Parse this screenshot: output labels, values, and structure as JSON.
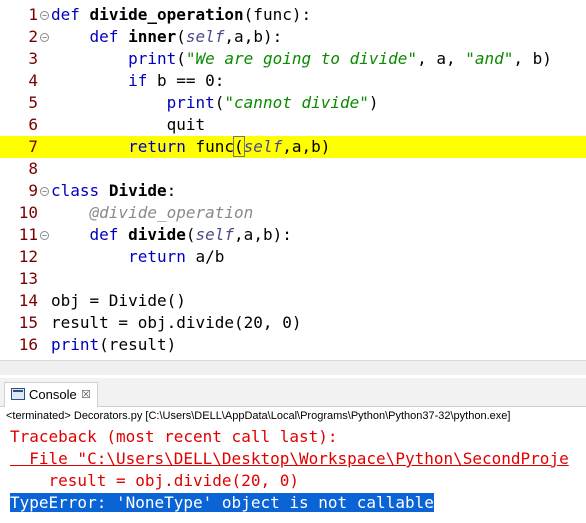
{
  "editor": {
    "lines": [
      {
        "num": "1",
        "fold": true,
        "highlight": false,
        "tokens": [
          {
            "t": "def",
            "c": "kw"
          },
          {
            "t": " "
          },
          {
            "t": "divide_operation",
            "c": "b"
          },
          {
            "t": "(func):"
          }
        ]
      },
      {
        "num": "2",
        "fold": true,
        "highlight": false,
        "tokens": [
          {
            "t": "    "
          },
          {
            "t": "def",
            "c": "kw"
          },
          {
            "t": " "
          },
          {
            "t": "inner",
            "c": "b"
          },
          {
            "t": "("
          },
          {
            "t": "self",
            "c": "self"
          },
          {
            "t": ",a,b):"
          }
        ]
      },
      {
        "num": "3",
        "fold": false,
        "highlight": false,
        "tokens": [
          {
            "t": "        "
          },
          {
            "t": "print",
            "c": "kw"
          },
          {
            "t": "("
          },
          {
            "t": "\"We are going to divide\"",
            "c": "str"
          },
          {
            "t": ", a, "
          },
          {
            "t": "\"and\"",
            "c": "str"
          },
          {
            "t": ", b)"
          }
        ]
      },
      {
        "num": "4",
        "fold": false,
        "highlight": false,
        "tokens": [
          {
            "t": "        "
          },
          {
            "t": "if",
            "c": "kw"
          },
          {
            "t": " b == 0:"
          }
        ]
      },
      {
        "num": "5",
        "fold": false,
        "highlight": false,
        "tokens": [
          {
            "t": "            "
          },
          {
            "t": "print",
            "c": "kw"
          },
          {
            "t": "("
          },
          {
            "t": "\"cannot divide\"",
            "c": "str"
          },
          {
            "t": ")"
          }
        ]
      },
      {
        "num": "6",
        "fold": false,
        "highlight": false,
        "tokens": [
          {
            "t": "            quit"
          }
        ]
      },
      {
        "num": "7",
        "fold": false,
        "highlight": true,
        "tokens": [
          {
            "t": "        "
          },
          {
            "t": "return",
            "c": "kw"
          },
          {
            "t": " func"
          },
          {
            "t": "(",
            "c": "bracket"
          },
          {
            "t": "self",
            "c": "self"
          },
          {
            "t": ",a,b)"
          }
        ]
      },
      {
        "num": "8",
        "fold": false,
        "highlight": false,
        "tokens": []
      },
      {
        "num": "9",
        "fold": true,
        "highlight": false,
        "tokens": [
          {
            "t": "class",
            "c": "kw"
          },
          {
            "t": " "
          },
          {
            "t": "Divide",
            "c": "b"
          },
          {
            "t": ":"
          }
        ]
      },
      {
        "num": "10",
        "fold": false,
        "highlight": false,
        "tokens": [
          {
            "t": "    "
          },
          {
            "t": "@divide_operation",
            "c": "dec"
          }
        ]
      },
      {
        "num": "11",
        "fold": true,
        "highlight": false,
        "tokens": [
          {
            "t": "    "
          },
          {
            "t": "def",
            "c": "kw"
          },
          {
            "t": " "
          },
          {
            "t": "divide",
            "c": "b"
          },
          {
            "t": "("
          },
          {
            "t": "self",
            "c": "self"
          },
          {
            "t": ",a,b):"
          }
        ]
      },
      {
        "num": "12",
        "fold": false,
        "highlight": false,
        "tokens": [
          {
            "t": "        "
          },
          {
            "t": "return",
            "c": "kw"
          },
          {
            "t": " a/b"
          }
        ]
      },
      {
        "num": "13",
        "fold": false,
        "highlight": false,
        "tokens": []
      },
      {
        "num": "14",
        "fold": false,
        "highlight": false,
        "tokens": [
          {
            "t": "obj = Divide()"
          }
        ]
      },
      {
        "num": "15",
        "fold": false,
        "highlight": false,
        "tokens": [
          {
            "t": "result = obj.divide(20, 0)"
          }
        ]
      },
      {
        "num": "16",
        "fold": false,
        "highlight": false,
        "tokens": [
          {
            "t": "print",
            "c": "kw"
          },
          {
            "t": "(result)"
          }
        ]
      }
    ]
  },
  "console": {
    "tab_label": "Console",
    "close_glyph": "☒",
    "terminated": "<terminated> Decorators.py [C:\\Users\\DELL\\AppData\\Local\\Programs\\Python\\Python37-32\\python.exe]",
    "lines": [
      {
        "text": "Traceback (most recent call last):",
        "style": "plain"
      },
      {
        "text": "  File \"C:\\Users\\DELL\\Desktop\\Workspace\\Python\\SecondProje",
        "style": "link"
      },
      {
        "text": "    result = obj.divide(20, 0)",
        "style": "plain"
      },
      {
        "text": "TypeError: 'NoneType' object is not callable",
        "style": "selected"
      }
    ]
  },
  "colors": {
    "keyword": "#0000c0",
    "string": "#0a8a00",
    "line_number": "#7a0000",
    "highlight": "#ffff00",
    "error": "#e00000",
    "selection": "#0a64d6"
  }
}
